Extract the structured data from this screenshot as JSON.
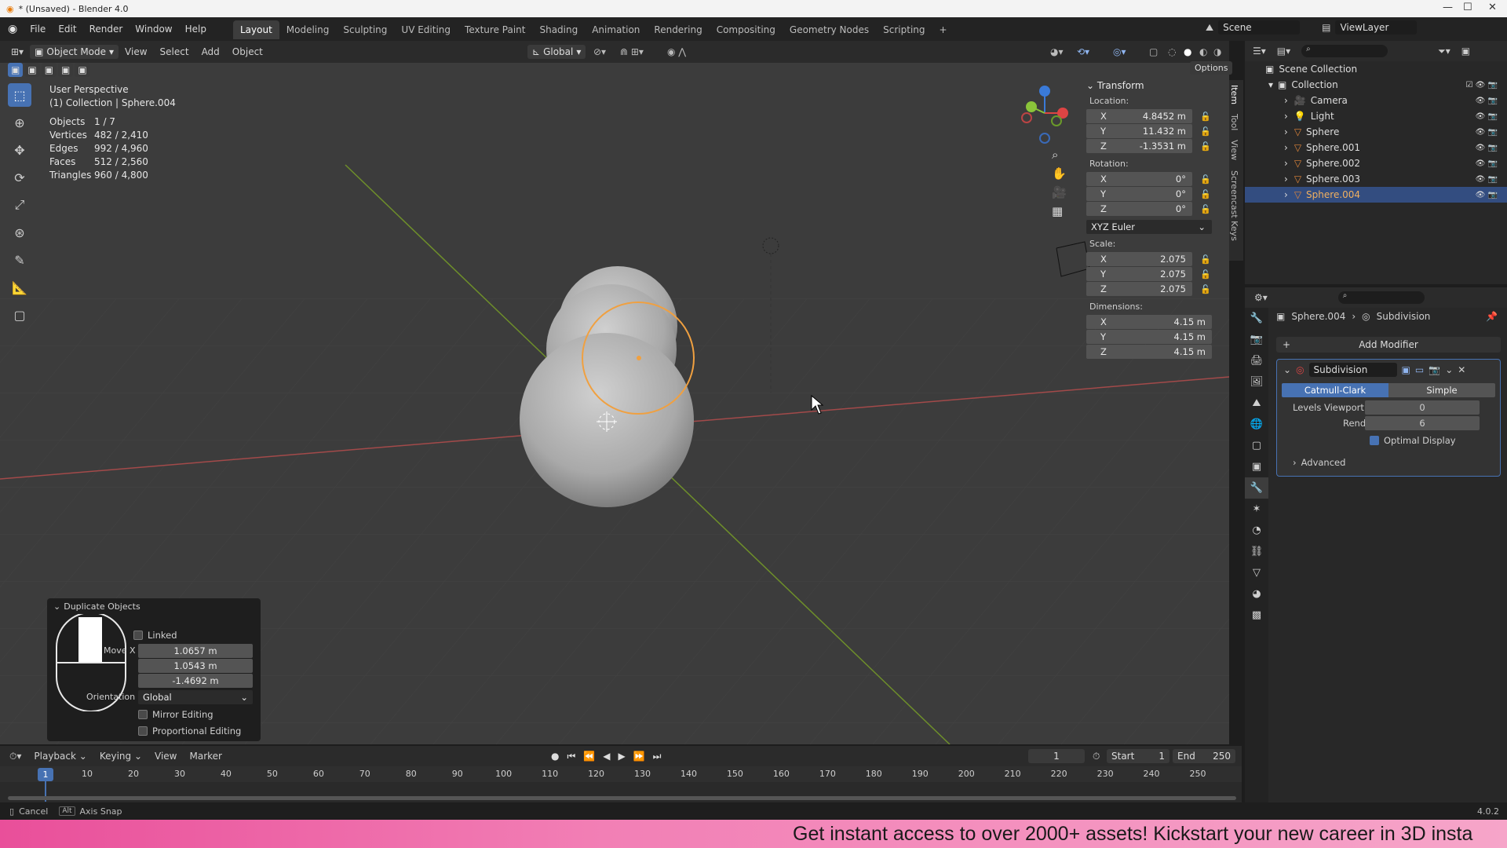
{
  "window": {
    "title": "* (Unsaved) - Blender 4.0"
  },
  "menu": [
    "File",
    "Edit",
    "Render",
    "Window",
    "Help"
  ],
  "workspaces": [
    "Layout",
    "Modeling",
    "Sculpting",
    "UV Editing",
    "Texture Paint",
    "Shading",
    "Animation",
    "Rendering",
    "Compositing",
    "Geometry Nodes",
    "Scripting"
  ],
  "scene_label": "Scene",
  "viewlayer_label": "ViewLayer",
  "viewport_header": {
    "mode": "Object Mode",
    "menus": [
      "View",
      "Select",
      "Add",
      "Object"
    ],
    "orientation": "Global",
    "options": "Options"
  },
  "viewport_info": {
    "line1": "User Perspective",
    "line2": "(1) Collection | Sphere.004"
  },
  "stats": [
    {
      "k": "Objects",
      "v": "1 / 7"
    },
    {
      "k": "Vertices",
      "v": "482 / 2,410"
    },
    {
      "k": "Edges",
      "v": "992 / 4,960"
    },
    {
      "k": "Faces",
      "v": "512 / 2,560"
    },
    {
      "k": "Triangles",
      "v": "960 / 4,800"
    }
  ],
  "transform": {
    "title": "Transform",
    "location_label": "Location:",
    "location": [
      {
        "a": "X",
        "v": "4.8452 m"
      },
      {
        "a": "Y",
        "v": "11.432 m"
      },
      {
        "a": "Z",
        "v": "-1.3531 m"
      }
    ],
    "rotation_label": "Rotation:",
    "rotation": [
      {
        "a": "X",
        "v": "0°"
      },
      {
        "a": "Y",
        "v": "0°"
      },
      {
        "a": "Z",
        "v": "0°"
      }
    ],
    "rotation_mode": "XYZ Euler",
    "scale_label": "Scale:",
    "scale": [
      {
        "a": "X",
        "v": "2.075"
      },
      {
        "a": "Y",
        "v": "2.075"
      },
      {
        "a": "Z",
        "v": "2.075"
      }
    ],
    "dimensions_label": "Dimensions:",
    "dimensions": [
      {
        "a": "X",
        "v": "4.15 m"
      },
      {
        "a": "Y",
        "v": "4.15 m"
      },
      {
        "a": "Z",
        "v": "4.15 m"
      }
    ]
  },
  "side_tabs": [
    "Item",
    "Tool",
    "View",
    "Screencast Keys"
  ],
  "outliner": {
    "root": "Scene Collection",
    "collection": "Collection",
    "items": [
      "Camera",
      "Light",
      "Sphere",
      "Sphere.001",
      "Sphere.002",
      "Sphere.003",
      "Sphere.004"
    ]
  },
  "properties": {
    "breadcrumb_object": "Sphere.004",
    "breadcrumb_modifier": "Subdivision",
    "add_modifier": "Add Modifier",
    "modifier_name": "Subdivision",
    "type_catmull": "Catmull-Clark",
    "type_simple": "Simple",
    "levels_viewport_label": "Levels Viewport",
    "levels_viewport": "0",
    "render_label": "Render",
    "render": "6",
    "optimal_display": "Optimal Display",
    "advanced": "Advanced"
  },
  "redo_panel": {
    "title": "Duplicate Objects",
    "linked": "Linked",
    "move_label": "Move X",
    "move": [
      "1.0657 m",
      "1.0543 m",
      "-1.4692 m"
    ],
    "orientation_label": "Orientation",
    "orientation": "Global",
    "mirror": "Mirror Editing",
    "proportional": "Proportional Editing"
  },
  "timeline": {
    "menus": [
      "Playback",
      "Keying",
      "View",
      "Marker"
    ],
    "current": "1",
    "start_label": "Start",
    "start": "1",
    "end_label": "End",
    "end": "250",
    "ticks": [
      "1",
      "10",
      "20",
      "30",
      "40",
      "50",
      "60",
      "70",
      "80",
      "90",
      "100",
      "110",
      "120",
      "130",
      "140",
      "150",
      "160",
      "170",
      "180",
      "190",
      "200",
      "210",
      "220",
      "230",
      "240",
      "250"
    ]
  },
  "statusbar": {
    "cancel": "Cancel",
    "alt": "Alt",
    "axis_snap": "Axis Snap",
    "version": "4.0.2"
  },
  "banner": "Get instant access to over 2000+ assets! Kickstart your new career in 3D insta",
  "colors": {
    "accent": "#4772b3",
    "selected_row": "#334d80",
    "selection_outline": "#f0a040"
  }
}
